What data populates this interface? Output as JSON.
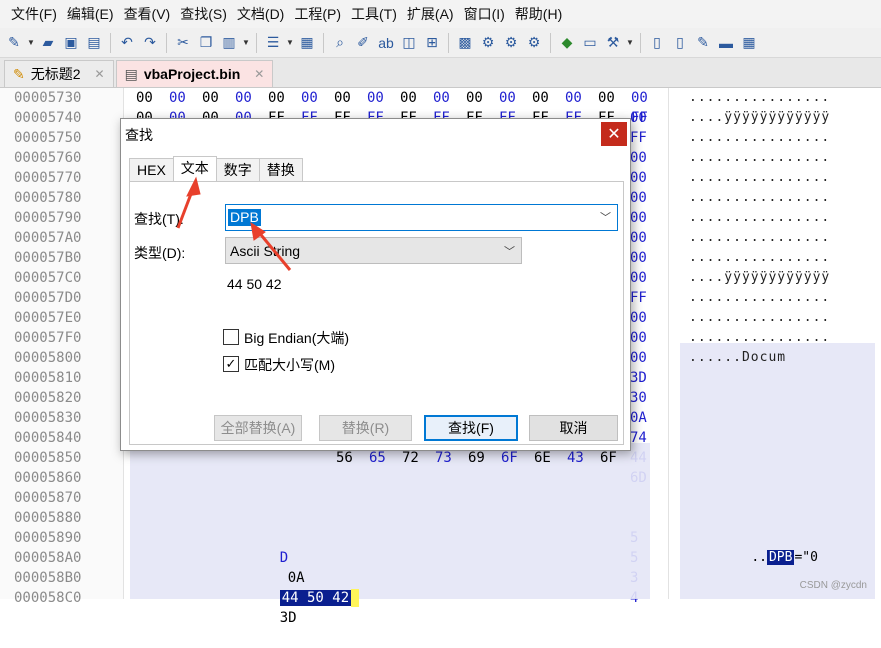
{
  "menubar": {
    "items": [
      "文件(F)",
      "编辑(E)",
      "查看(V)",
      "查找(S)",
      "文档(D)",
      "工程(P)",
      "工具(T)",
      "扩展(A)",
      "窗口(I)",
      "帮助(H)"
    ]
  },
  "tabs": [
    {
      "label": "无标题2",
      "active": false
    },
    {
      "label": "vbaProject.bin",
      "active": true
    }
  ],
  "addresses": [
    "00005730",
    "00005740",
    "00005750",
    "00005760",
    "00005770",
    "00005780",
    "00005790",
    "000057A0",
    "000057B0",
    "000057C0",
    "000057D0",
    "000057E0",
    "000057F0",
    "00005800",
    "00005810",
    "00005820",
    "00005830",
    "00005840",
    "00005850",
    "00005860",
    "00005870",
    "00005880",
    "00005890",
    "000058A0",
    "000058B0",
    "000058C0"
  ],
  "hex_rows": [
    [
      "00",
      "00",
      "00",
      "00",
      "00",
      "00",
      "00",
      "00",
      "00",
      "00",
      "00",
      "00",
      "00",
      "00",
      "00",
      "00"
    ],
    [
      "00",
      "00",
      "00",
      "00",
      "FF",
      "FF",
      "FF",
      "FF",
      "FF",
      "FF",
      "FF",
      "FF",
      "FF",
      "FF",
      "FF",
      "FF"
    ]
  ],
  "right_hex_col": [
    "00",
    "FF",
    "00",
    "00",
    "00",
    "00",
    "00",
    "00",
    "00",
    "FF",
    "00",
    "00",
    "00",
    "3D",
    "30",
    "0A",
    "74",
    "44",
    "6D",
    "",
    "",
    "5",
    "5",
    "3",
    "4"
  ],
  "ascii_rows": [
    "................",
    "....ÿÿÿÿÿÿÿÿÿÿÿÿ",
    "................",
    "................",
    "................",
    "................",
    "................",
    "................",
    "................",
    "....ÿÿÿÿÿÿÿÿÿÿÿÿ",
    "................",
    "................",
    "................",
    "......Docum"
  ],
  "row_5850": [
    "56",
    "65",
    "72",
    "73",
    "69",
    "6F",
    "6E",
    "43",
    "6F"
  ],
  "highlight": {
    "hex_prefix": "D",
    "hex_0a": "0A",
    "hex_sel": "44 50 42",
    "hex_after": "3D",
    "ascii_prefix": "..",
    "ascii_sel": "DPB",
    "ascii_after": "=\"0"
  },
  "dialog": {
    "title": "查找",
    "close": "✕",
    "tabs": [
      "HEX",
      "文本",
      "数字",
      "替换"
    ],
    "active_tab": "文本",
    "find_label": "查找(T):",
    "find_value": "DPB",
    "type_label": "类型(D):",
    "type_value": "Ascii String",
    "hex_preview": "44 50 42",
    "big_endian_label": "Big Endian(大端)",
    "big_endian_checked": false,
    "match_case_label": "匹配大小写(M)",
    "match_case_checked": true,
    "buttons": {
      "replace_all": "全部替换(A)",
      "replace": "替换(R)",
      "find": "查找(F)",
      "cancel": "取消"
    }
  },
  "watermark": "CSDN @zycdn",
  "colors": {
    "accent": "#0078d4",
    "arrow": "#e8402c",
    "selection": "#0a1f8f",
    "hexblue": "#1f1fd0"
  }
}
